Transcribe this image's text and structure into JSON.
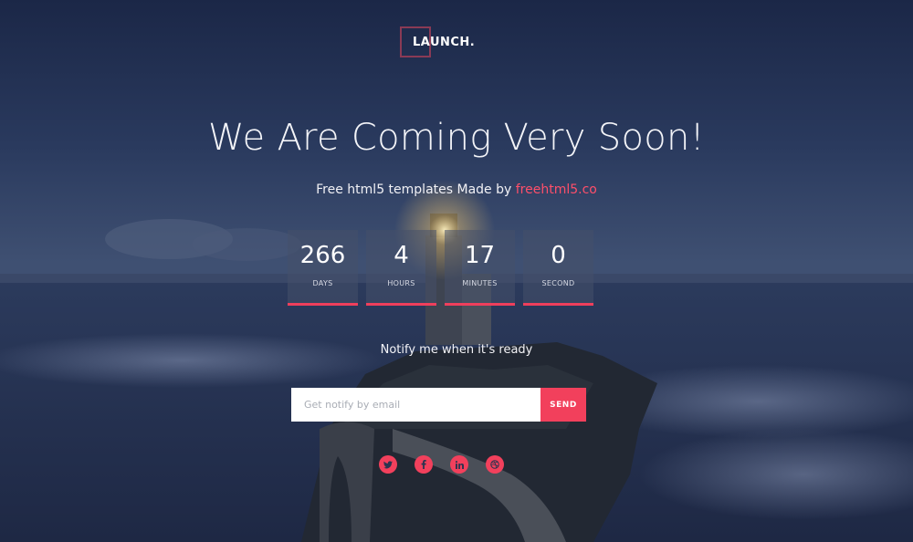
{
  "logo": {
    "text": "LAUNCH.",
    "accent_color": "#8a3a55"
  },
  "headline": "We Are Coming Very Soon!",
  "subline": {
    "prefix": "Free html5 templates Made by ",
    "brand": "freehtml5.co",
    "brand_color": "#ff4f6a"
  },
  "countdown": [
    {
      "value": "266",
      "label": "DAYS"
    },
    {
      "value": "4",
      "label": "HOURS"
    },
    {
      "value": "17",
      "label": "MINUTES"
    },
    {
      "value": "0",
      "label": "SECOND"
    }
  ],
  "notify": {
    "title": "Notify me when it's ready",
    "placeholder": "Get notify by email",
    "send_label": "SEND",
    "button_color": "#f2405c"
  },
  "social": [
    {
      "name": "twitter",
      "icon": "twitter-icon"
    },
    {
      "name": "facebook",
      "icon": "facebook-icon"
    },
    {
      "name": "linkedin",
      "icon": "linkedin-icon"
    },
    {
      "name": "dribbble",
      "icon": "dribbble-icon"
    }
  ]
}
